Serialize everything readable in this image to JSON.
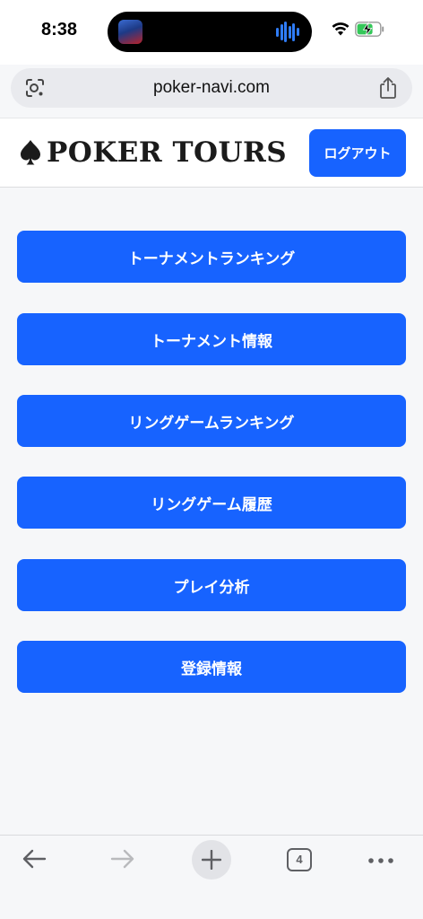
{
  "status_bar": {
    "time": "8:38"
  },
  "browser": {
    "url": "poker-navi.com"
  },
  "header": {
    "logo_text": "POKER TOURS",
    "logout_label": "ログアウト"
  },
  "menu": [
    {
      "label": "トーナメントランキング"
    },
    {
      "label": "トーナメント情報"
    },
    {
      "label": "リングゲームランキング"
    },
    {
      "label": "リングゲーム履歴"
    },
    {
      "label": "プレイ分析"
    },
    {
      "label": "登録情報"
    }
  ],
  "toolbar": {
    "tab_count": "4"
  },
  "colors": {
    "accent": "#1763ff",
    "background": "#f6f7f9"
  },
  "icons": [
    "wifi-icon",
    "battery-charging-icon",
    "lens-icon",
    "share-icon",
    "spade-icon",
    "back-arrow-icon",
    "forward-arrow-icon",
    "plus-icon",
    "tabs-icon",
    "more-icon"
  ]
}
